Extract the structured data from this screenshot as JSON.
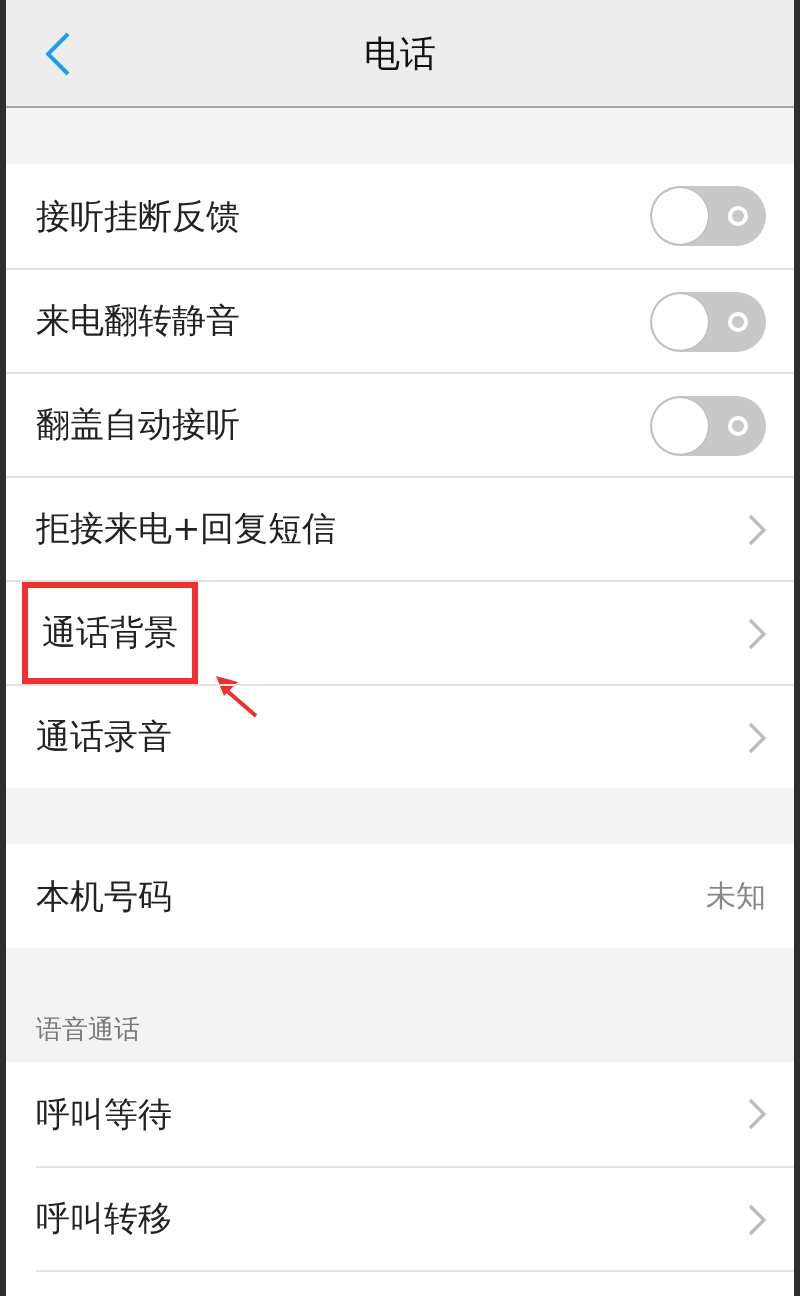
{
  "header": {
    "title": "电话"
  },
  "groups": [
    {
      "items": [
        {
          "kind": "toggle",
          "label": "接听挂断反馈",
          "on": false
        },
        {
          "kind": "toggle",
          "label": "来电翻转静音",
          "on": false
        },
        {
          "kind": "toggle",
          "label": "翻盖自动接听",
          "on": false
        },
        {
          "kind": "link",
          "label": "拒接来电+回复短信"
        },
        {
          "kind": "link",
          "label": "通话背景",
          "highlighted": true
        },
        {
          "kind": "link",
          "label": "通话录音"
        }
      ]
    },
    {
      "items": [
        {
          "kind": "value",
          "label": "本机号码",
          "value": "未知"
        }
      ]
    },
    {
      "title": "语音通话",
      "items": [
        {
          "kind": "link",
          "label": "呼叫等待"
        },
        {
          "kind": "link",
          "label": "呼叫转移"
        },
        {
          "kind": "blank"
        }
      ]
    }
  ]
}
